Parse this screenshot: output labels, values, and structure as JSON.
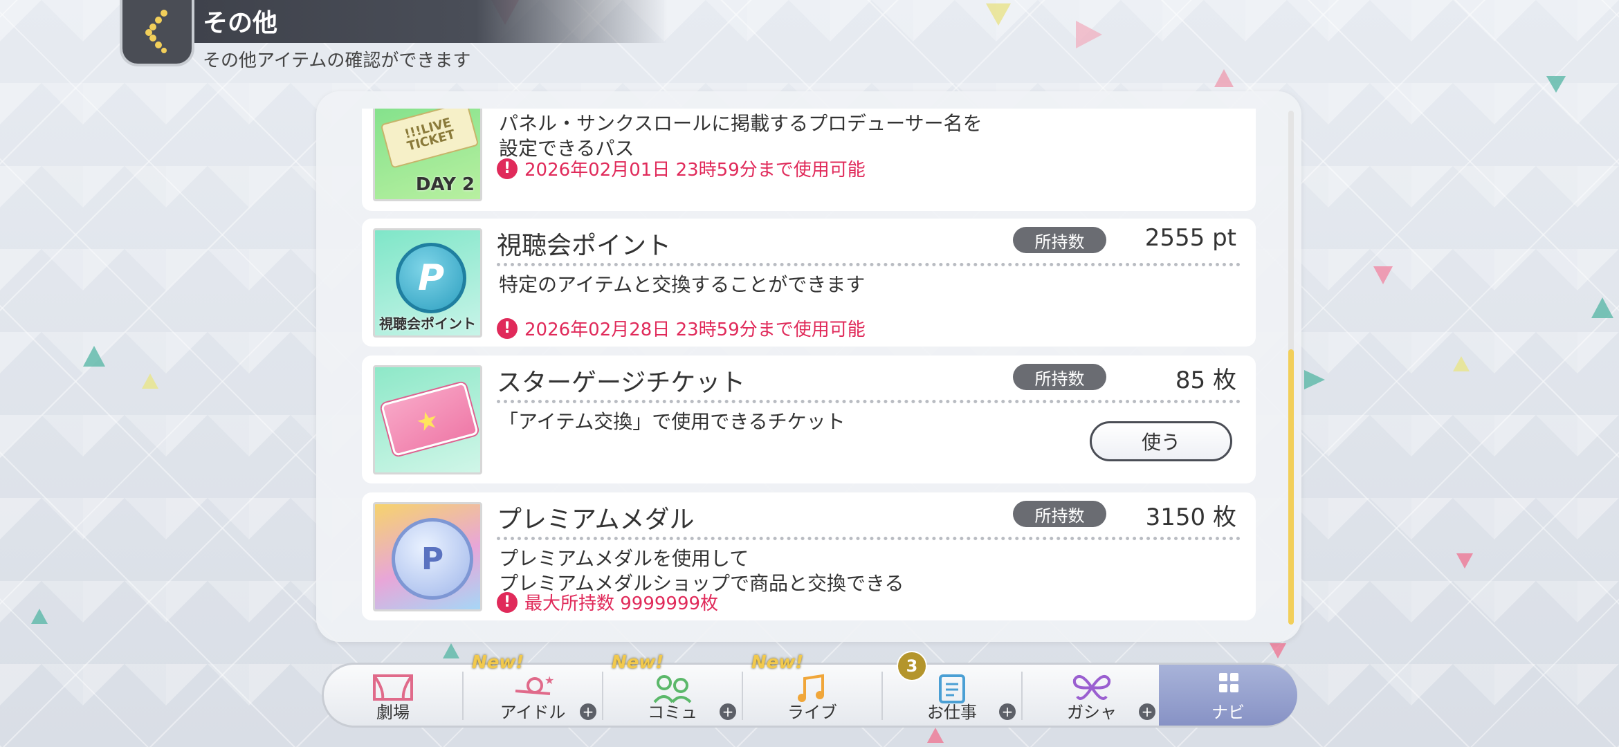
{
  "header": {
    "title": "その他",
    "subtitle": "その他アイテムの確認ができます"
  },
  "items": [
    {
      "name": "",
      "thumb_text": "DAY 2",
      "thumb_ticket": "!!!LIVE TICKET",
      "badge": "",
      "qty": "",
      "desc_lines": [
        "パネル・サンクスロールに掲載するプロデューサー名を",
        "設定できるパス"
      ],
      "warning": "2026年02月01日 23時59分まで使用可能"
    },
    {
      "name": "視聴会ポイント",
      "thumb_text": "視聴会ポイント",
      "thumb_letter": "P",
      "badge": "所持数",
      "qty": "2555 pt",
      "desc_lines": [
        "特定のアイテムと交換することができます"
      ],
      "warning": "2026年02月28日 23時59分まで使用可能"
    },
    {
      "name": "スターゲージチケット",
      "badge": "所持数",
      "qty": "85 枚",
      "desc_lines": [
        "「アイテム交換」で使用できるチケット"
      ],
      "use_button": "使う"
    },
    {
      "name": "プレミアムメダル",
      "badge": "所持数",
      "qty": "3150 枚",
      "desc_lines": [
        "プレミアムメダルを使用して",
        "プレミアムメダルショップで商品と交換できる"
      ],
      "warning": "最大所持数 9999999枚"
    }
  ],
  "nav": {
    "items": [
      {
        "label": "劇場",
        "new": "",
        "plus": false
      },
      {
        "label": "アイドル",
        "new": "New!",
        "plus": true
      },
      {
        "label": "コミュ",
        "new": "New!",
        "plus": true
      },
      {
        "label": "ライブ",
        "new": "New!",
        "plus": false
      },
      {
        "label": "お仕事",
        "new": "",
        "plus": true,
        "count": "3"
      },
      {
        "label": "ガシャ",
        "new": "",
        "plus": true
      },
      {
        "label": "ナビ",
        "new": "",
        "plus": false,
        "active": true
      }
    ]
  },
  "colors": {
    "warning": "#e02a5a",
    "scroll_thumb": "#f2cf5a",
    "nav_active": "#8792c5"
  }
}
